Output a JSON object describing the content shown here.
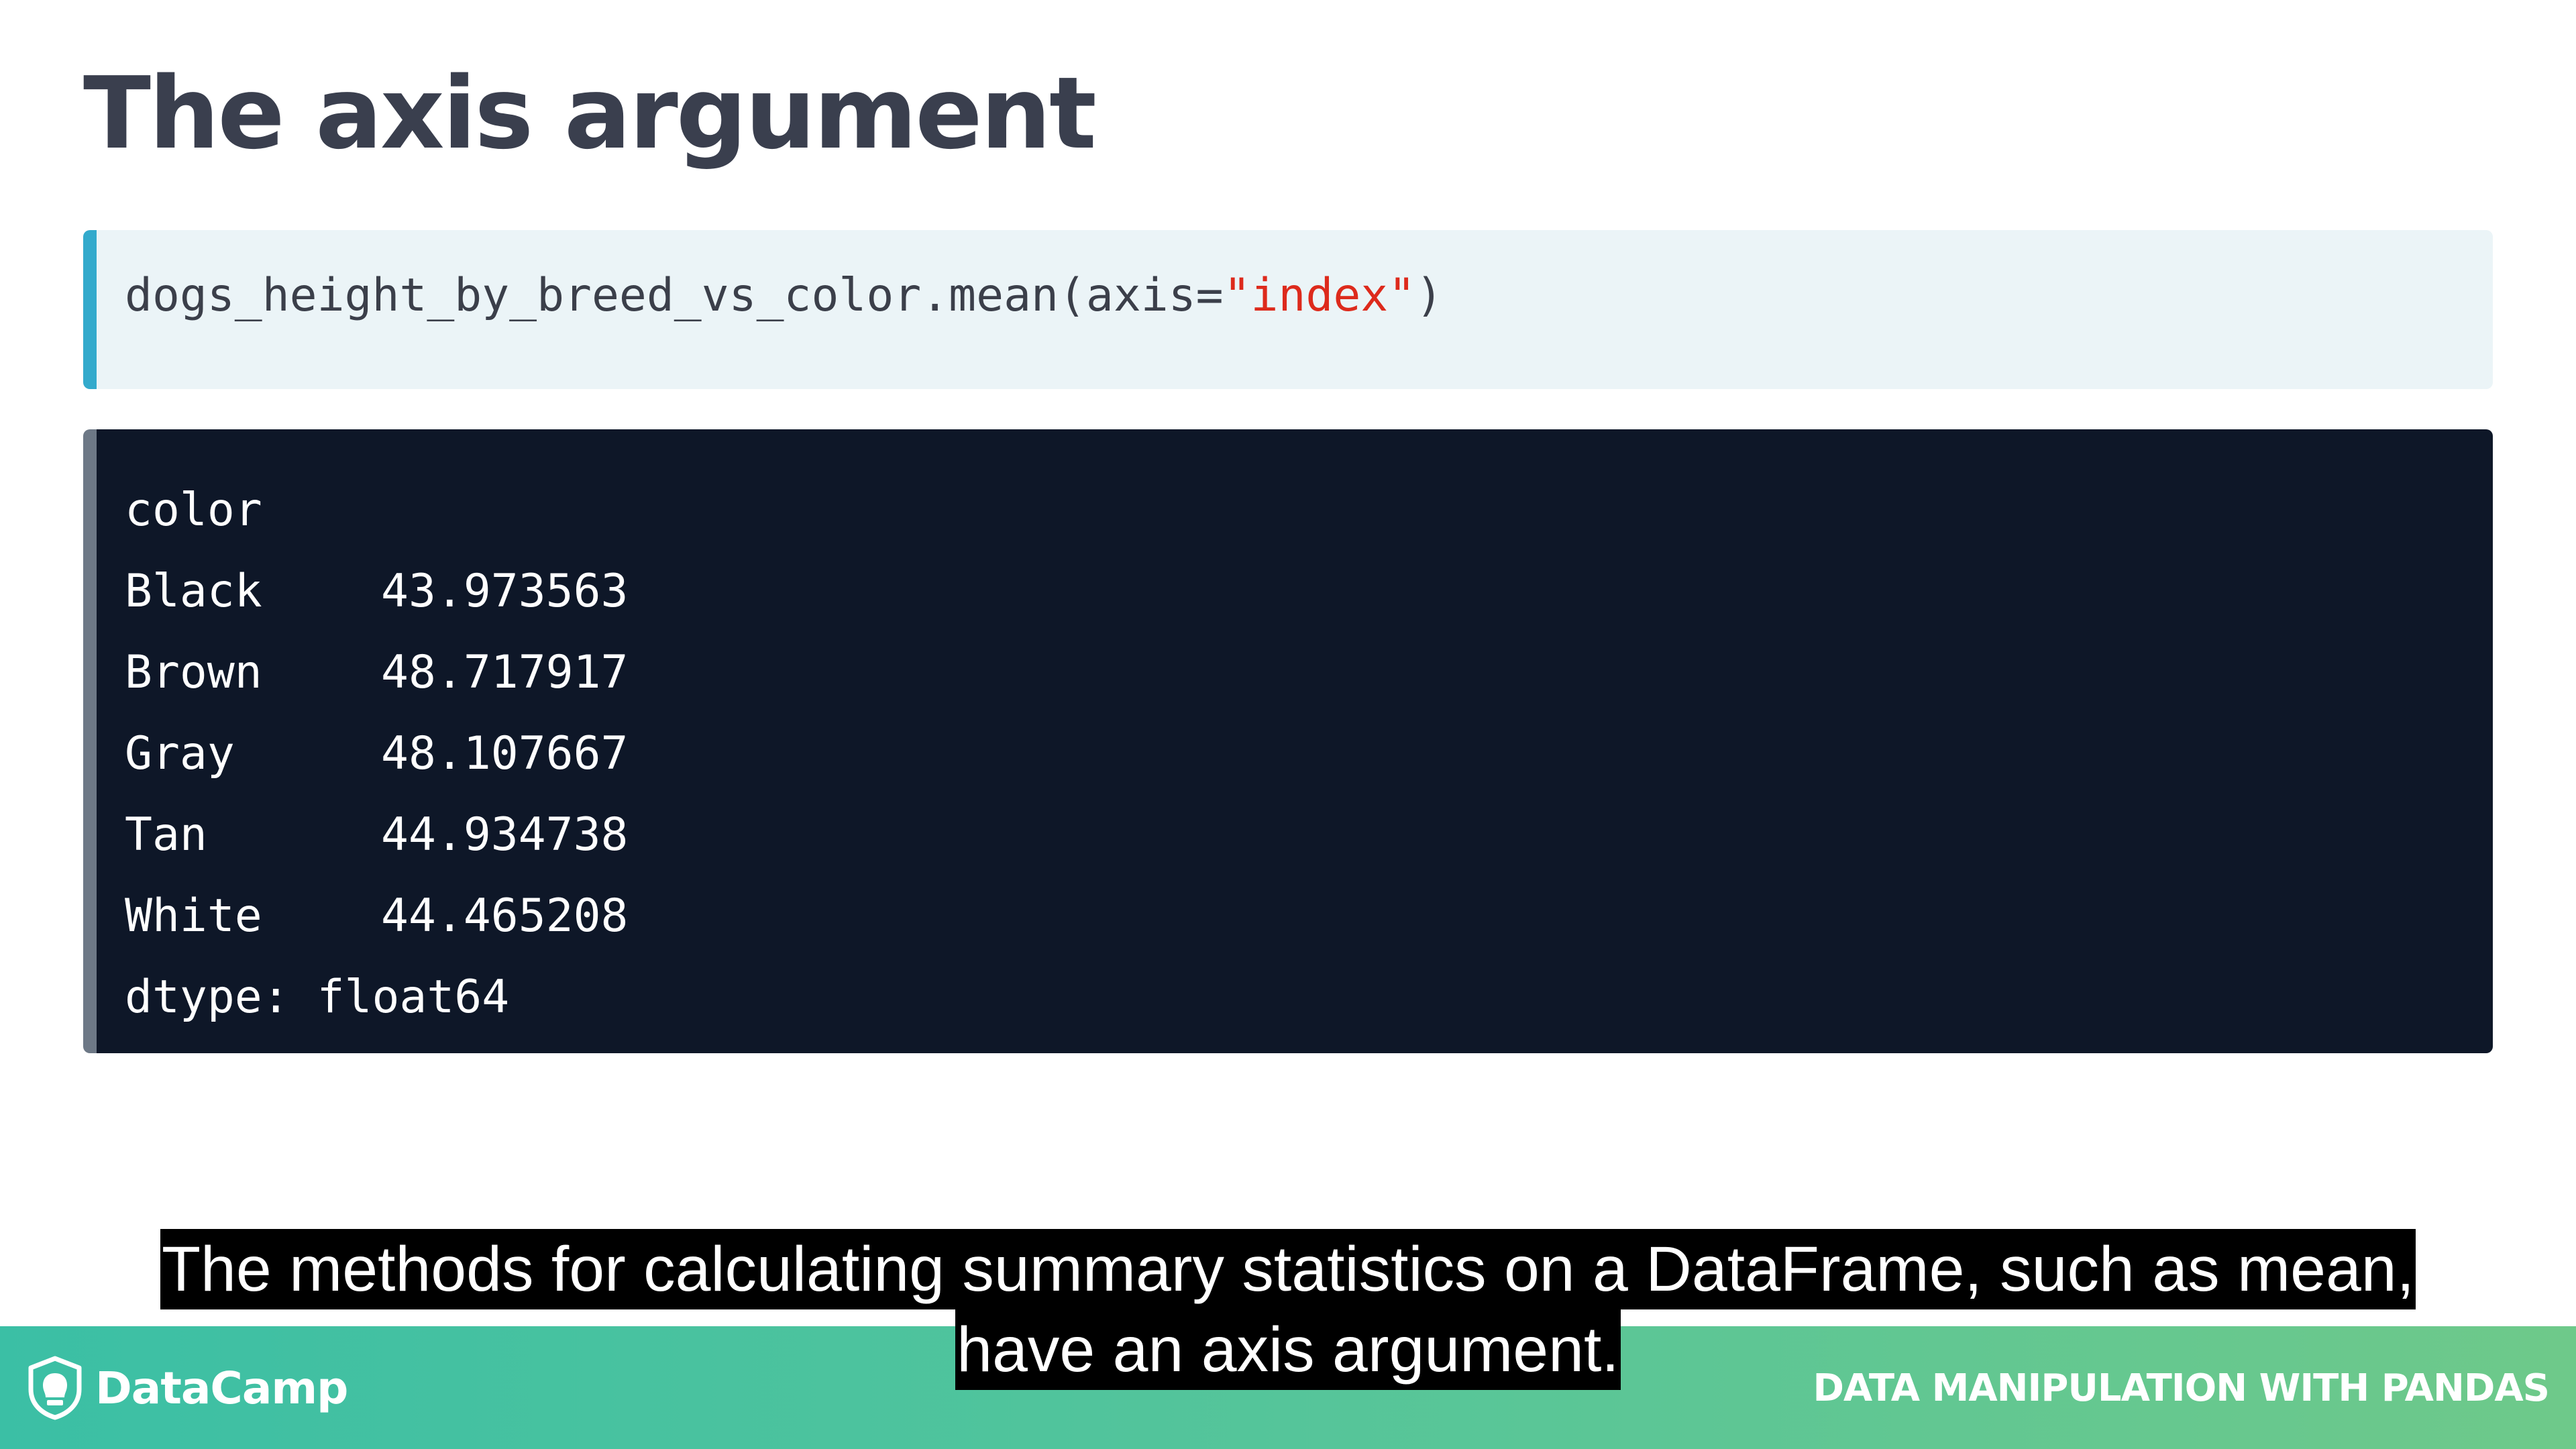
{
  "slide": {
    "title": "The axis argument"
  },
  "code_input": {
    "prefix": "dogs_height_by_breed_vs_color.mean(axis=",
    "string_arg": "\"index\"",
    "suffix": ")"
  },
  "code_output": {
    "header": "color",
    "rows": [
      {
        "label": "Black",
        "value": "43.973563"
      },
      {
        "label": "Brown",
        "value": "48.717917"
      },
      {
        "label": "Gray",
        "value": "48.107667"
      },
      {
        "label": "Tan",
        "value": "44.934738"
      },
      {
        "label": "White",
        "value": "44.465208"
      }
    ],
    "dtype": "dtype: float64"
  },
  "caption": {
    "line1": "The methods for calculating summary statistics on a DataFrame, such as mean,",
    "line2": "have an axis argument."
  },
  "footer": {
    "brand": "DataCamp",
    "course": "DATA MANIPULATION WITH PANDAS",
    "logo_icon": "datacamp-shield-icon"
  },
  "colors": {
    "title": "#3a3f4e",
    "code_bg": "#ebf4f7",
    "code_accent": "#33aacc",
    "string": "#dd2a1c",
    "output_bg": "#0e1728",
    "output_accent": "#6d7886",
    "footer_start": "#3bbfa5",
    "footer_end": "#6ec98a"
  }
}
